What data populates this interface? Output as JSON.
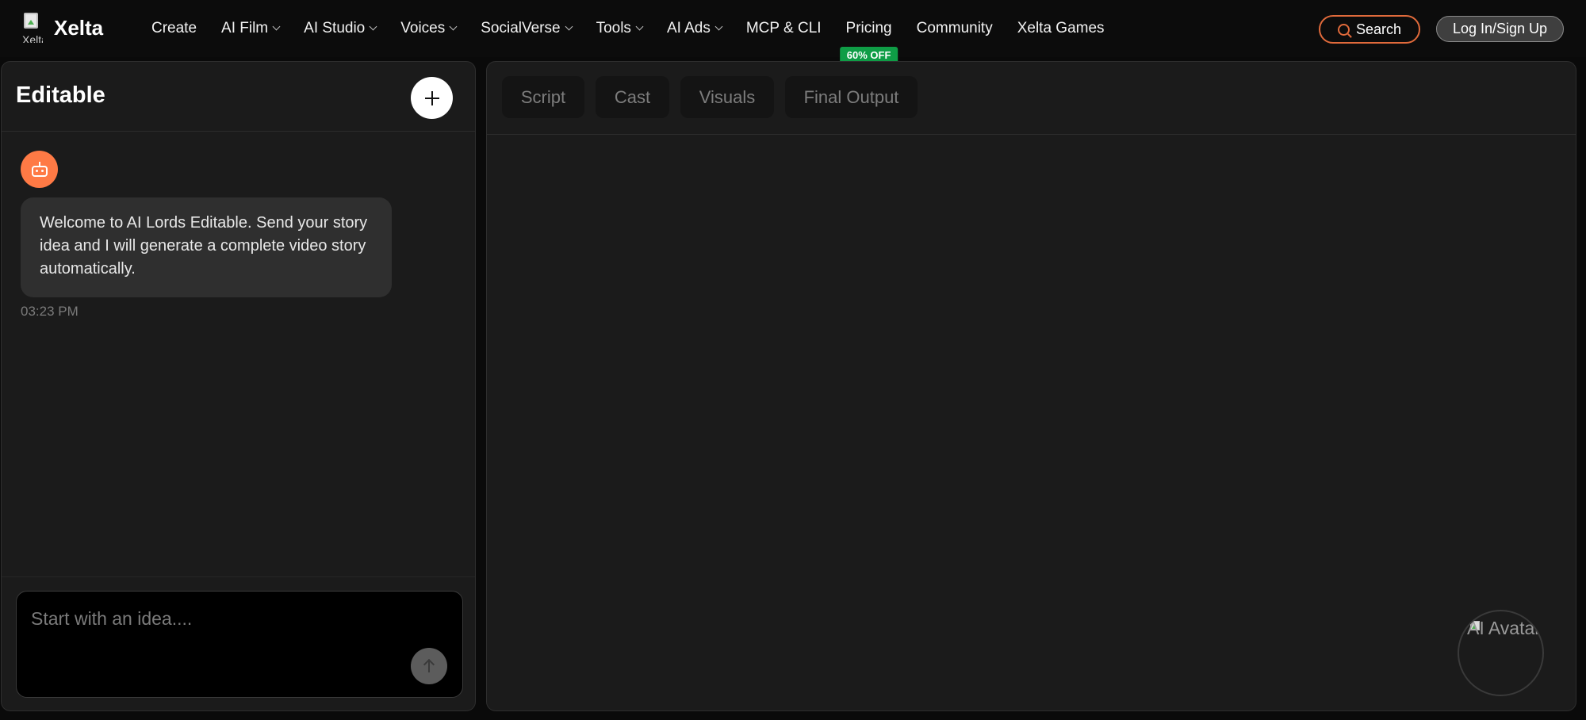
{
  "brand": {
    "name": "Xelta",
    "logo_alt": "Xelta"
  },
  "nav": {
    "items": [
      {
        "label": "Create",
        "dropdown": false
      },
      {
        "label": "AI Film",
        "dropdown": true
      },
      {
        "label": "AI Studio",
        "dropdown": true
      },
      {
        "label": "Voices",
        "dropdown": true
      },
      {
        "label": "SocialVerse",
        "dropdown": true
      },
      {
        "label": "Tools",
        "dropdown": true
      },
      {
        "label": "AI Ads",
        "dropdown": true
      },
      {
        "label": "MCP & CLI",
        "dropdown": false
      },
      {
        "label": "Pricing",
        "dropdown": false,
        "badge": "60% OFF"
      },
      {
        "label": "Community",
        "dropdown": false
      },
      {
        "label": "Xelta Games",
        "dropdown": false
      }
    ],
    "search_label": "Search",
    "login_label": "Log In/Sign Up"
  },
  "chat": {
    "title": "Editable",
    "messages": [
      {
        "sender": "bot",
        "text": "Welcome to AI Lords Editable. Send your story idea and I will generate a complete video story automatically.",
        "time": "03:23 PM"
      }
    ],
    "input_placeholder": "Start with an idea...."
  },
  "workspace": {
    "tabs": [
      "Script",
      "Cast",
      "Visuals",
      "Final Output"
    ],
    "avatar_alt": "AI Avatar"
  },
  "colors": {
    "accent_orange": "#ff7a45",
    "badge_green": "#0f9d46",
    "search_border": "#e06a3b",
    "panel_bg": "#1b1b1b"
  }
}
